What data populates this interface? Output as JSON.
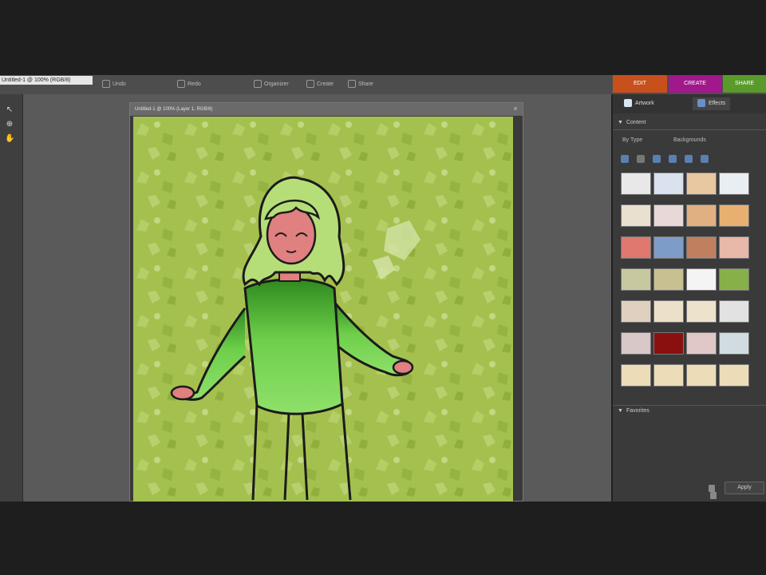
{
  "app": {
    "file_tab": "Untitled-1 @ 100% (RGB/8)",
    "toolbar": [
      {
        "label": "Undo",
        "icon": "undo-icon"
      },
      {
        "label": "Redo",
        "icon": "redo-icon"
      },
      {
        "label": "Organizer",
        "icon": "organizer-icon"
      },
      {
        "label": "Create",
        "icon": "create-icon"
      },
      {
        "label": "Share",
        "icon": "share-icon"
      }
    ],
    "mode_tabs": [
      {
        "label": "EDIT",
        "color": "#c8501c"
      },
      {
        "label": "CREATE",
        "color": "#a0188c"
      },
      {
        "label": "SHARE",
        "color": "#5a9a2a"
      }
    ]
  },
  "document": {
    "title": "Untitled-1 @ 100% (Layer 1, RGB/8)",
    "canvas_bg": "#a4c14f"
  },
  "panel": {
    "tabs": [
      {
        "label": "Artwork",
        "icon": "artwork-icon"
      },
      {
        "label": "Effects",
        "icon": "effects-icon"
      }
    ],
    "content_section": "Content",
    "filter_label": "By Type",
    "filter_value": "Backgrounds",
    "thumbnails": [
      "#e8e8e8",
      "#d9e2ee",
      "#e8c8a0",
      "#e9eef2",
      "#eae0cf",
      "#e8d8d8",
      "#e0b080",
      "#e8b070",
      "#e07870",
      "#7e9cc8",
      "#c08060",
      "#e8b8a8",
      "#c8c8a0",
      "#c8c090",
      "#f4f4f4",
      "#88b048",
      "#e0d0c0",
      "#ede0c8",
      "#ede3cc",
      "#e2e2e2",
      "#d8c8c8",
      "#8a1010",
      "#e0c8c8",
      "#d0dce0",
      "#ecdcb8",
      "#ecdcb8",
      "#ecdcb8",
      "#ecdcb8"
    ],
    "apply_label": "Apply",
    "favorites_section": "Favorites"
  }
}
